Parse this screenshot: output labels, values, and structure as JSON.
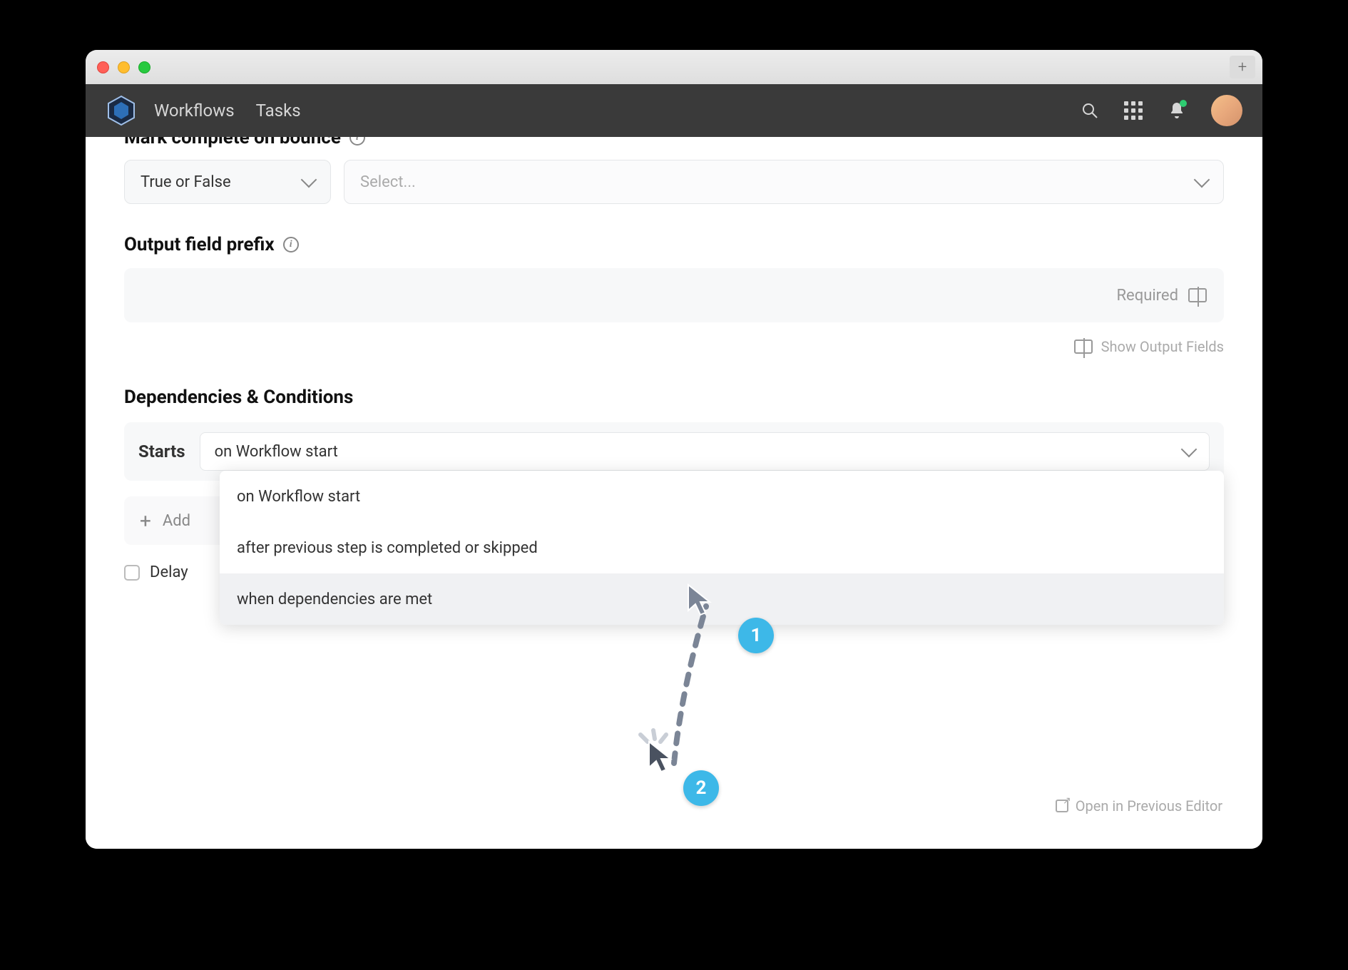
{
  "nav": {
    "link1": "Workflows",
    "link2": "Tasks"
  },
  "section_cut": "Mark complete on bounce",
  "select1": "True or False",
  "select2_placeholder": "Select...",
  "output_prefix_label": "Output field prefix",
  "required_label": "Required",
  "show_output_label": "Show Output Fields",
  "dep_heading": "Dependencies & Conditions",
  "starts_label": "Starts",
  "starts_value": "on Workflow start",
  "dropdown": {
    "opt1": "on Workflow start",
    "opt2": "after previous step is completed or skipped",
    "opt3": "when dependencies are met"
  },
  "add_cond_label": "Add",
  "delay_label": "Delay",
  "open_prev_label": "Open in Previous Editor",
  "annotations": {
    "badge1": "1",
    "badge2": "2"
  }
}
